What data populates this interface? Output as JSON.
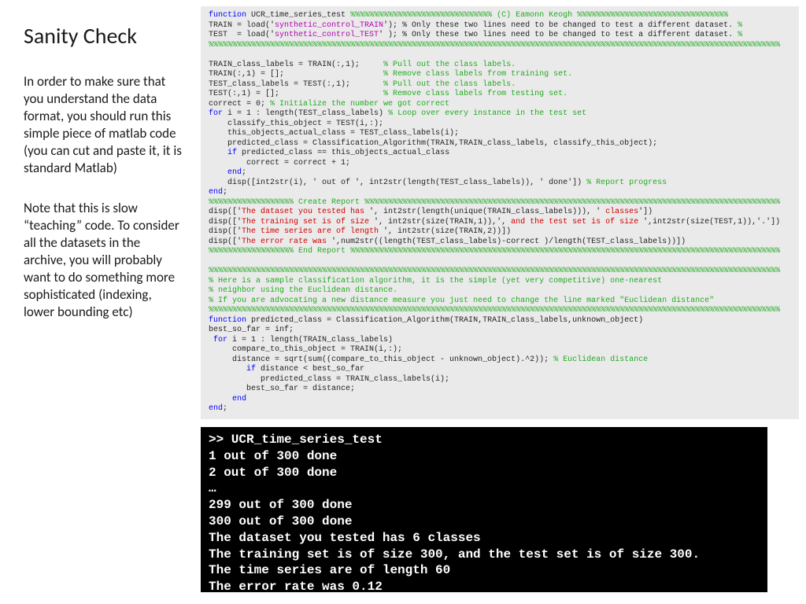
{
  "left": {
    "title": "Sanity Check",
    "para1": "In order to make sure that you understand the data format, you should run this simple piece of matlab code (you can cut and paste it, it is standard Matlab)",
    "para2": "Note that this is slow “teaching” code. To consider all the datasets in the archive, you will probably want to do something more sophisticated (indexing, lower bounding etc)"
  },
  "code": {
    "l1a": "function",
    "l1b": " UCR_time_series_test ",
    "l1c": "%%%%%%%%%%%%%%%%%%%%%%%%%%%%%% (C) Eamonn Keogh %%%%%%%%%%%%%%%%%%%%%%%%%%%%%%%%",
    "l2a": "TRAIN = load('",
    "l2b": "synthetic_control_TRAIN",
    "l2c": "'); % Only these two lines need to be changed to test a different dataset. ",
    "l2d": "%",
    "l3a": "TEST  = load('",
    "l3b": "synthetic_control_TEST",
    "l3c": "' ); % Only these two lines need to be changed to test a different dataset. ",
    "l3d": "%",
    "l4": "%%%%%%%%%%%%%%%%%%%%%%%%%%%%%%%%%%%%%%%%%%%%%%%%%%%%%%%%%%%%%%%%%%%%%%%%%%%%%%%%%%%%%%%%%%%%%%%%%%%%%%%%%%%%%%%%%%%%%%%%%",
    "l6a": "TRAIN_class_labels = TRAIN(:,1);     ",
    "l6b": "% Pull out the class labels.",
    "l7a": "TRAIN(:,1) = [];                     ",
    "l7b": "% Remove class labels from training set.",
    "l8a": "TEST_class_labels = TEST(:,1);       ",
    "l8b": "% Pull out the class labels.",
    "l9a": "TEST(:,1) = [];                      ",
    "l9b": "% Remove class labels from testing set.",
    "l10a": "correct = 0; ",
    "l10b": "% Initialize the number we got correct",
    "l11a": "for",
    "l11b": " i = 1 : length(TEST_class_labels) ",
    "l11c": "% Loop over every instance in the test set",
    "l12": "    classify_this_object = TEST(i,:);",
    "l13": "    this_objects_actual_class = TEST_class_labels(i);",
    "l14": "    predicted_class = Classification_Algorithm(TRAIN,TRAIN_class_labels, classify_this_object);",
    "l15a": "    ",
    "l15b": "if",
    "l15c": " predicted_class == this_objects_actual_class",
    "l16": "        correct = correct + 1;",
    "l17a": "    ",
    "l17b": "end",
    "l17c": ";",
    "l18a": "    disp([int2str(i), ' out of ', int2str(length(TEST_class_labels)), ' done']) ",
    "l18b": "% Report progress",
    "l19a": "end",
    "l19b": ";",
    "l20": "%%%%%%%%%%%%%%%%%% Create Report %%%%%%%%%%%%%%%%%%%%%%%%%%%%%%%%%%%%%%%%%%%%%%%%%%%%%%%%%%%%%%%%%%%%%%%%%%%%%%%%%%%%%%%%",
    "l21a": "disp(['",
    "l21b": "The dataset you tested has ",
    "l21c": "', int2str(length(unique(TRAIN_class_labels))), '",
    "l21d": " classes",
    "l21e": "'])",
    "l22a": "disp(['",
    "l22b": "The training set is of size ",
    "l22c": "', int2str(size(TRAIN,1)),', ",
    "l22d": "and the test set is of size ",
    "l22e": "',int2str(size(TEST,1)),'.'])",
    "l23a": "disp(['",
    "l23b": "The time series are of length ",
    "l23c": "', int2str(size(TRAIN,2))])",
    "l24a": "disp(['",
    "l24b": "The error rate was ",
    "l24c": "',num2str((length(TEST_class_labels)-correct )/length(TEST_class_labels))])",
    "l25": "%%%%%%%%%%%%%%%%%% End Report %%%%%%%%%%%%%%%%%%%%%%%%%%%%%%%%%%%%%%%%%%%%%%%%%%%%%%%%%%%%%%%%%%%%%%%%%%%%%%%%%%%%%%%%%%%",
    "l27": "%%%%%%%%%%%%%%%%%%%%%%%%%%%%%%%%%%%%%%%%%%%%%%%%%%%%%%%%%%%%%%%%%%%%%%%%%%%%%%%%%%%%%%%%%%%%%%%%%%%%%%%%%%%%%%%%%%%%%%%%%",
    "l28": "% Here is a sample classification algorithm, it is the simple (yet very competitive) one-nearest",
    "l29": "% neighbor using the Euclidean distance.",
    "l30": "% If you are advocating a new distance measure you just need to change the line marked \"Euclidean distance\"",
    "l31": "%%%%%%%%%%%%%%%%%%%%%%%%%%%%%%%%%%%%%%%%%%%%%%%%%%%%%%%%%%%%%%%%%%%%%%%%%%%%%%%%%%%%%%%%%%%%%%%%%%%%%%%%%%%%%%%%%%%%%%%%%",
    "l32a": "function",
    "l32b": " predicted_class = Classification_Algorithm(TRAIN,TRAIN_class_labels,unknown_object)",
    "l33": "best_so_far = inf;",
    "l34a": " for",
    "l34b": " i = 1 : length(TRAIN_class_labels)",
    "l35": "     compare_to_this_object = TRAIN(i,:);",
    "l36a": "     distance = sqrt(sum((compare_to_this_object - unknown_object).^2)); ",
    "l36b": "% Euclidean distance",
    "l37a": "        ",
    "l37b": "if",
    "l37c": " distance < best_so_far",
    "l38": "           predicted_class = TRAIN_class_labels(i);",
    "l39": "        best_so_far = distance;",
    "l40a": "     ",
    "l40b": "end",
    "l41a": "end",
    "l41b": ";"
  },
  "console": {
    "l1": ">> UCR_time_series_test",
    "l2": "1 out of 300 done",
    "l3": "2 out of 300 done",
    "l4": "…",
    "l5": "299 out of 300 done",
    "l6": "300 out of 300 done",
    "l7": "The dataset you tested has 6 classes",
    "l8": "The training set is of size 300, and the test set is of size 300.",
    "l9": "The time series are of length 60",
    "l10": "The error rate was 0.12"
  }
}
